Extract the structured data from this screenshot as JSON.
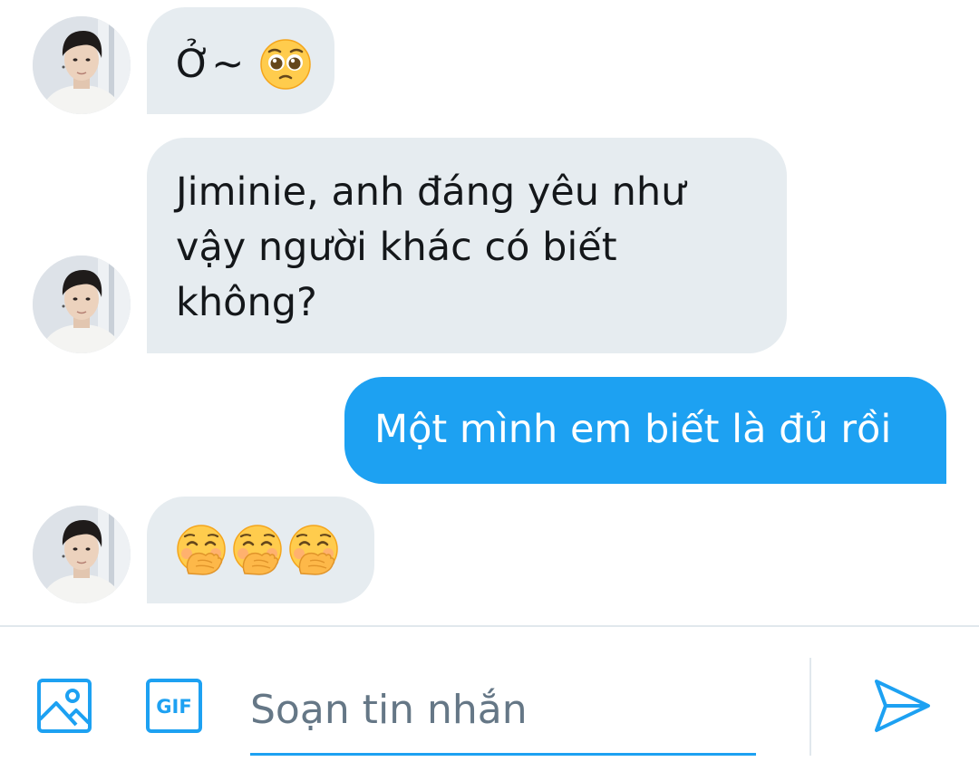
{
  "messages": [
    {
      "direction": "incoming",
      "text": "Ở~",
      "emojis": [
        "pleading-face"
      ]
    },
    {
      "direction": "incoming",
      "text": "Jiminie, anh đáng yêu như vậy người khác có biết không?"
    },
    {
      "direction": "outgoing",
      "text": "Một mình em biết là đủ rồi"
    },
    {
      "direction": "incoming",
      "text": "",
      "emojis": [
        "hand-over-mouth-face",
        "hand-over-mouth-face",
        "hand-over-mouth-face"
      ]
    }
  ],
  "composer": {
    "placeholder": "Soạn tin nhắn",
    "gif_label": "GIF",
    "icons": {
      "media": "image-icon",
      "gif": "gif-icon",
      "send": "send-icon"
    }
  },
  "colors": {
    "accent": "#1da1f2",
    "incoming_bubble": "#e6ecf0",
    "outgoing_text": "#ffffff",
    "text": "#14171a",
    "placeholder": "#657786",
    "divider": "#e1e8ed"
  }
}
